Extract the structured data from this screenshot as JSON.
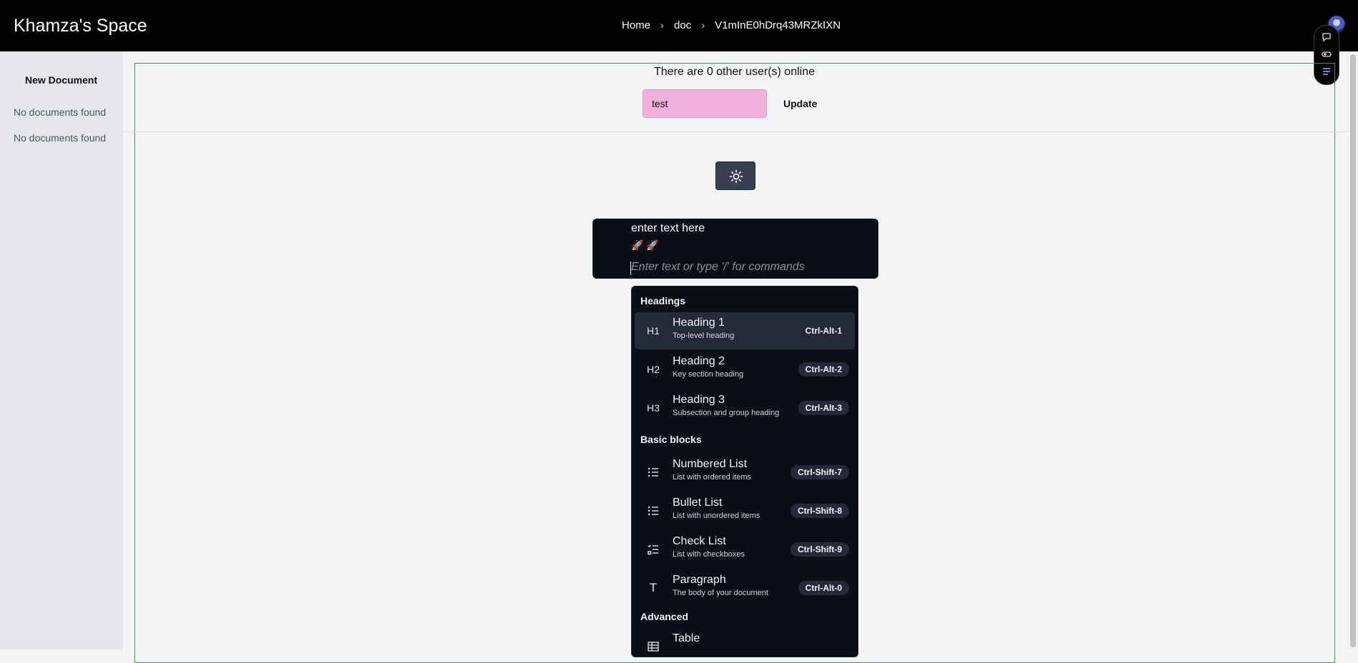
{
  "header": {
    "app_title": "Khamza's Space",
    "breadcrumbs": [
      "Home",
      "doc",
      "V1mInE0hDrq43MRZkIXN"
    ]
  },
  "sidebar": {
    "new_document": "New Document",
    "empty_items": [
      "No documents found",
      "No documents found"
    ]
  },
  "presence": {
    "online_text": "There are 0 other user(s) online",
    "name_value": "test",
    "update_label": "Update"
  },
  "editor": {
    "lines": [
      "enter text here",
      "🚀 🚀"
    ],
    "placeholder": "Enter text or type '/' for commands"
  },
  "slash_menu": {
    "groups": [
      {
        "label": "Headings",
        "items": [
          {
            "icon": "H1",
            "title": "Heading 1",
            "subtitle": "Top-level heading",
            "shortcut": "Ctrl-Alt-1",
            "active": true
          },
          {
            "icon": "H2",
            "title": "Heading 2",
            "subtitle": "Key section heading",
            "shortcut": "Ctrl-Alt-2"
          },
          {
            "icon": "H3",
            "title": "Heading 3",
            "subtitle": "Subsection and group heading",
            "shortcut": "Ctrl-Alt-3"
          }
        ]
      },
      {
        "label": "Basic blocks",
        "items": [
          {
            "icon": "numbered-list-icon",
            "title": "Numbered List",
            "subtitle": "List with ordered items",
            "shortcut": "Ctrl-Shift-7"
          },
          {
            "icon": "bullet-list-icon",
            "title": "Bullet List",
            "subtitle": "List with unordered items",
            "shortcut": "Ctrl-Shift-8"
          },
          {
            "icon": "check-list-icon",
            "title": "Check List",
            "subtitle": "List with checkboxes",
            "shortcut": "Ctrl-Shift-9"
          },
          {
            "icon": "T",
            "title": "Paragraph",
            "subtitle": "The body of your document",
            "shortcut": "Ctrl-Alt-0"
          }
        ]
      },
      {
        "label": "Advanced",
        "items": [
          {
            "icon": "table-icon",
            "title": "Table",
            "subtitle": "",
            "shortcut": ""
          }
        ]
      }
    ]
  },
  "toolbar_icons": [
    "comment-icon",
    "toggle-icon",
    "outline-icon"
  ],
  "colors": {
    "topbar": "#000000",
    "sidebar": "#e5e7eb",
    "editor_bg": "#0b0d17",
    "name_input_bg": "#efb0d9",
    "frame_border": "#4d8a5a"
  }
}
